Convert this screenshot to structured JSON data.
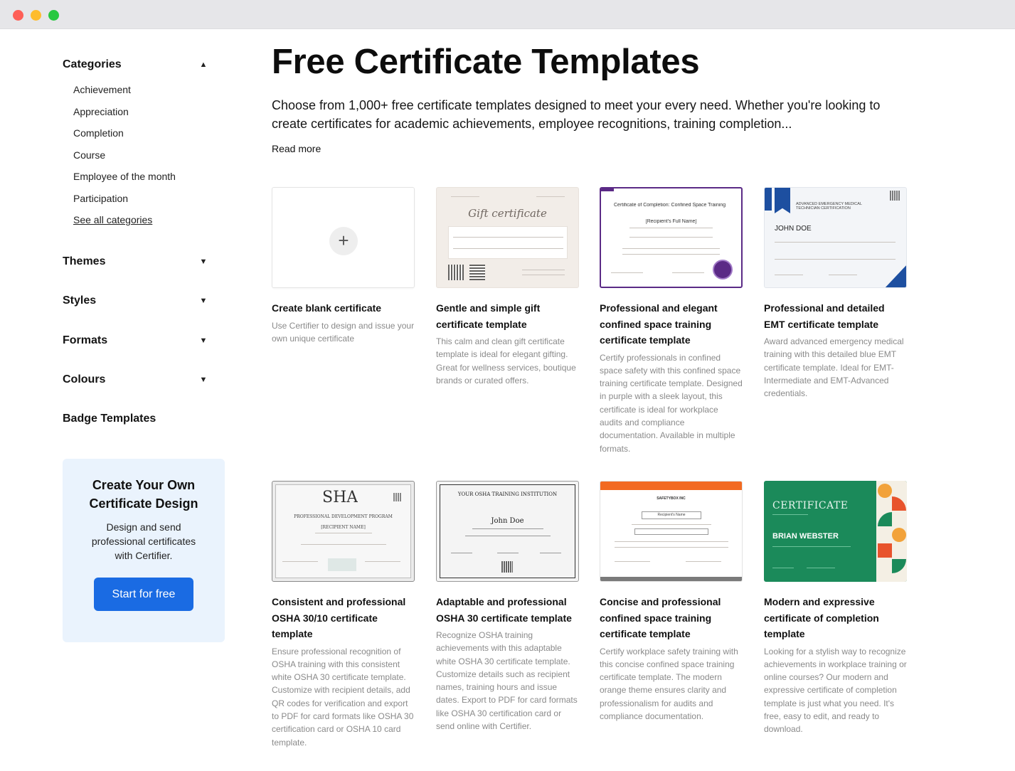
{
  "window": {
    "buttons": [
      "close",
      "minimize",
      "maximize"
    ]
  },
  "sidebar": {
    "categories_title": "Categories",
    "categories": [
      {
        "label": "Achievement"
      },
      {
        "label": "Appreciation"
      },
      {
        "label": "Completion"
      },
      {
        "label": "Course"
      },
      {
        "label": "Employee of the month"
      },
      {
        "label": "Participation"
      },
      {
        "label": "See all categories"
      }
    ],
    "sections": [
      {
        "label": "Themes"
      },
      {
        "label": "Styles"
      },
      {
        "label": "Formats"
      },
      {
        "label": "Colours"
      }
    ],
    "badge_templates": "Badge Templates",
    "promo": {
      "title": "Create Your Own Certificate Design",
      "text": "Design and send professional certificates with Certifier.",
      "button": "Start for free"
    }
  },
  "main": {
    "title": "Free Certificate Templates",
    "intro": "Choose from 1,000+ free certificate templates designed to meet your every need. Whether you're looking to create certificates for academic achievements, employee recognitions, training completion...",
    "read_more": "Read more"
  },
  "cards": [
    {
      "title": "Create blank certificate",
      "desc": "Use Certifier to design and issue your own unique certificate"
    },
    {
      "title": "Gentle and simple gift certificate template",
      "desc": "This calm and clean gift certificate template is ideal for elegant gifting. Great for wellness services, boutique brands or curated offers.",
      "thumb_text": "Gift certificate"
    },
    {
      "title": "Professional and elegant confined space training certificate template",
      "desc": "Certify professionals in confined space safety with this confined space training certificate template. Designed in purple with a sleek layout, this certificate is ideal for workplace audits and compliance documentation. Available in multiple formats.",
      "thumb_text": "Certificate of Completion: Confined Space Training",
      "thumb_sub": "[Recipient's Full Name]"
    },
    {
      "title": "Professional and detailed EMT certificate template",
      "desc": "Award advanced emergency medical training with this detailed blue EMT certificate template. Ideal for EMT-Intermediate and EMT-Advanced credentials.",
      "thumb_text": "ADVANCED EMERGENCY MEDICAL TECHNICIAN CERTIFICATION",
      "thumb_sub": "JOHN DOE"
    },
    {
      "title": "Consistent and professional OSHA 30/10 certificate template",
      "desc": "Ensure professional recognition of OSHA training with this consistent white OSHA 30 certificate template. Customize with recipient details, add QR codes for verification and export to PDF for card formats like OSHA 30 certification card or OSHA 10 card template.",
      "thumb_text": "SHA",
      "thumb_sub": "PROFESSIONAL DEVELOPMENT PROGRAM",
      "thumb_name": "[RECIPIENT NAME]"
    },
    {
      "title": "Adaptable and professional OSHA 30 certificate template",
      "desc": "Recognize OSHA training achievements with this adaptable white OSHA 30 certificate template. Customize details such as recipient names, training hours and issue dates. Export to PDF for card formats like OSHA 30 certification card or send online with Certifier.",
      "thumb_text": "YOUR OSHA TRAINING INSTITUTION",
      "thumb_sub": "John Doe"
    },
    {
      "title": "Concise and professional confined space training certificate template",
      "desc": "Certify workplace safety training with this concise confined space training certificate template. The modern orange theme ensures clarity and professionalism for audits and compliance documentation.",
      "thumb_text": "SAFETYBOX INC",
      "thumb_sub": "Recipient's Name"
    },
    {
      "title": "Modern and expressive certificate of completion template",
      "desc": "Looking for a stylish way to recognize achievements in workplace training or online courses? Our modern and expressive certificate of completion template is just what you need. It's free, easy to edit, and ready to download.",
      "thumb_text": "CERTIFICATE",
      "thumb_sub": "BRIAN WEBSTER"
    }
  ],
  "colors": {
    "accent": "#1a6be3",
    "promo_bg": "#eaf3fd",
    "purple": "#5b2a86",
    "emt_blue": "#1d4fa0",
    "orange": "#f26a21",
    "green": "#1b8a5a"
  }
}
